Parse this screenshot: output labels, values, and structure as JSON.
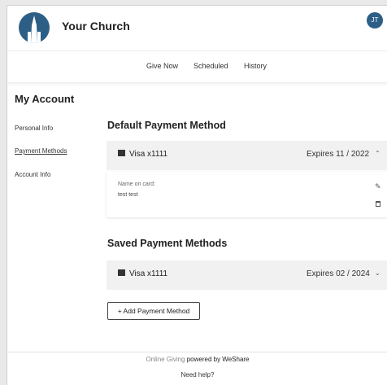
{
  "header": {
    "church_name": "Your Church",
    "user_initials": "JT"
  },
  "nav": {
    "tabs": [
      "Give Now",
      "Scheduled",
      "History"
    ]
  },
  "sidebar": {
    "title": "My Account",
    "items": [
      "Personal Info",
      "Payment Methods",
      "Account Info"
    ],
    "active": "Payment Methods"
  },
  "default_section": {
    "title": "Default Payment Method",
    "card": {
      "brand": "Visa x1111",
      "expires": "Expires 11 / 2022"
    },
    "details": {
      "name_label": "Name on card:",
      "name_value": "test test"
    }
  },
  "saved_section": {
    "title": "Saved Payment Methods",
    "cards": [
      {
        "brand": "Visa x1111",
        "expires": "Expires 02 / 2024"
      }
    ]
  },
  "add_button": "+ Add Payment Method",
  "footer": {
    "prefix": "Online Giving ",
    "powered": "powered by WeShare",
    "help": "Need help?"
  },
  "icons": {
    "chevron_up": "⌃",
    "chevron_down": "⌄",
    "pencil": "✎"
  },
  "colors": {
    "brand": "#2d5f86"
  }
}
